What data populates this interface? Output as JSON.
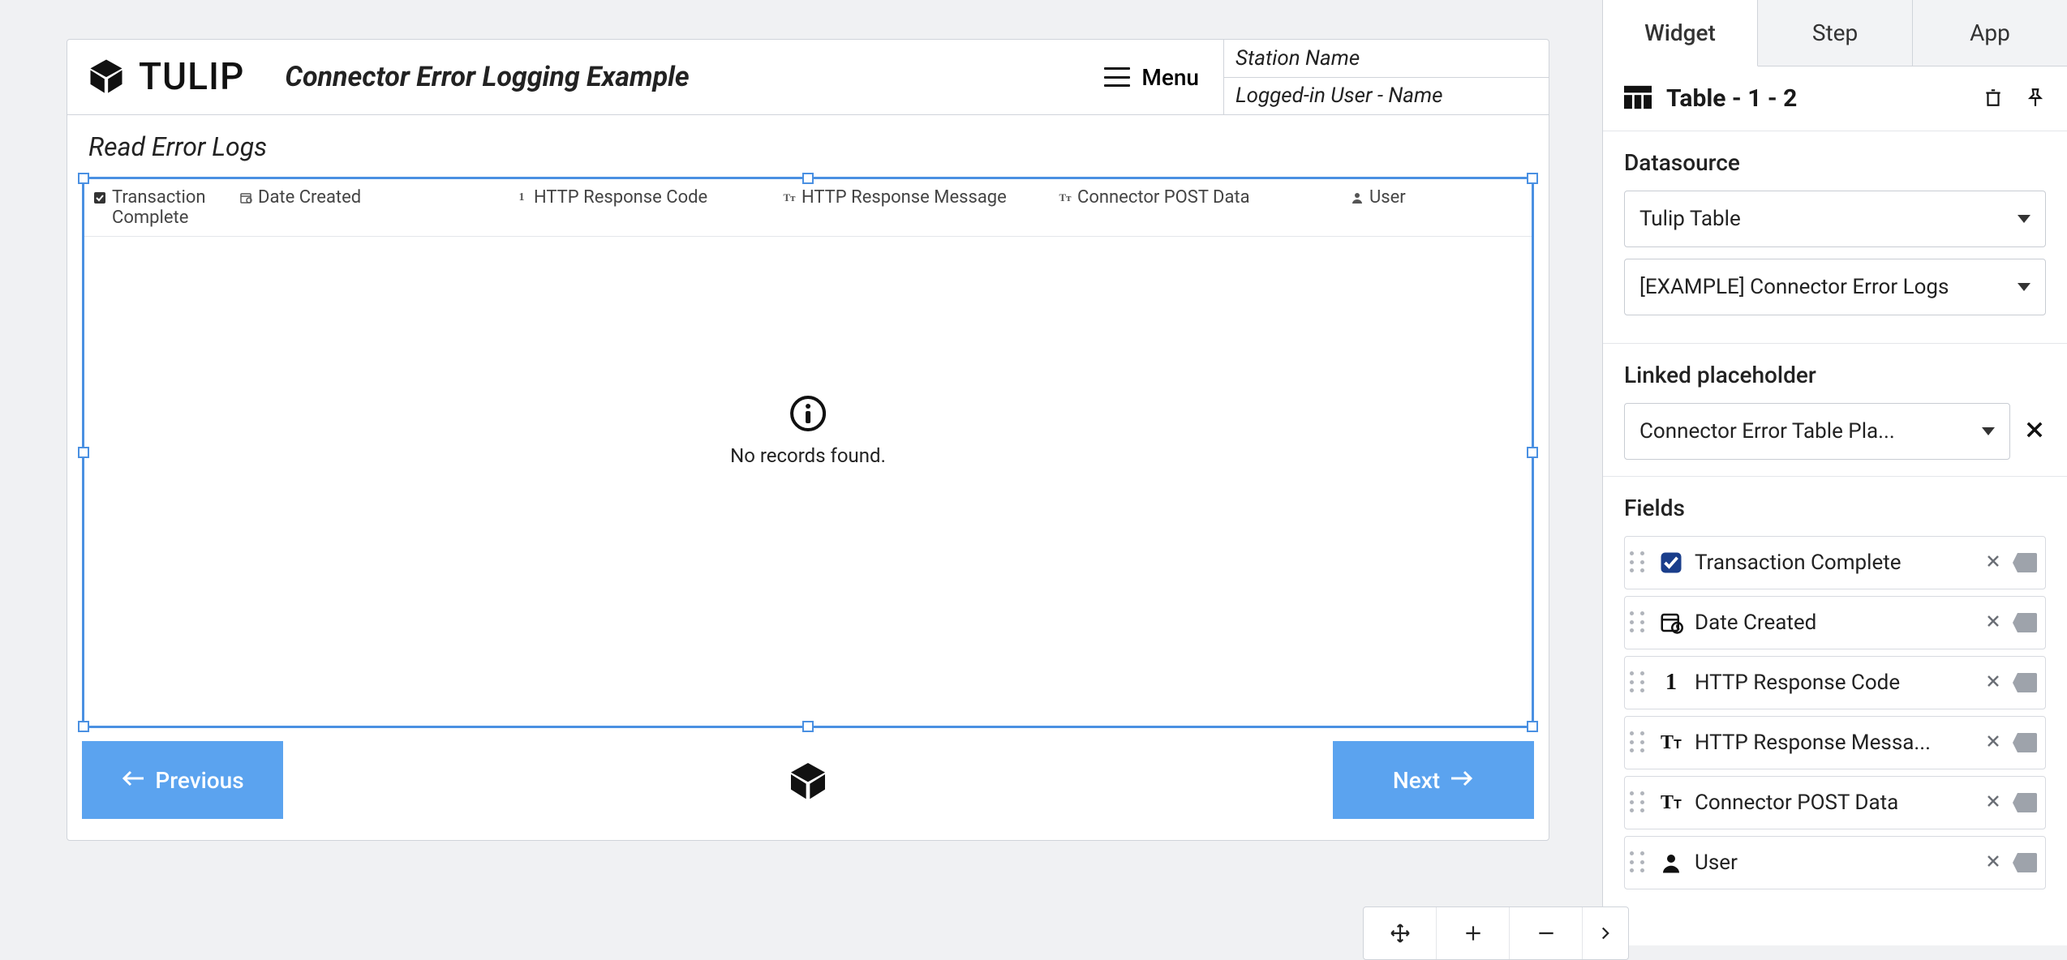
{
  "app": {
    "brand": "TULIP",
    "title": "Connector Error Logging Example",
    "menu_label": "Menu",
    "station_label": "Station Name",
    "user_label": "Logged-in User - Name"
  },
  "body": {
    "subtitle": "Read Error Logs",
    "columns": [
      "Transaction Complete",
      "Date Created",
      "HTTP Response Code",
      "HTTP Response Message",
      "Connector POST Data",
      "User"
    ],
    "empty_message": "No records found."
  },
  "footer": {
    "prev_label": "Previous",
    "next_label": "Next"
  },
  "sidebar": {
    "tabs": [
      "Widget",
      "Step",
      "App"
    ],
    "active_tab": 0,
    "widget_title": "Table - 1 - 2",
    "datasource": {
      "heading": "Datasource",
      "type_value": "Tulip Table",
      "table_value": "[EXAMPLE] Connector Error Logs"
    },
    "linked": {
      "heading": "Linked placeholder",
      "value": "Connector Error Table Pla..."
    },
    "fields": {
      "heading": "Fields",
      "items": [
        {
          "type": "checkbox",
          "label": "Transaction Complete"
        },
        {
          "type": "date",
          "label": "Date Created"
        },
        {
          "type": "number",
          "label": "HTTP Response Code"
        },
        {
          "type": "text",
          "label": "HTTP Response Messa..."
        },
        {
          "type": "text",
          "label": "Connector POST Data"
        },
        {
          "type": "user",
          "label": "User"
        }
      ]
    }
  }
}
